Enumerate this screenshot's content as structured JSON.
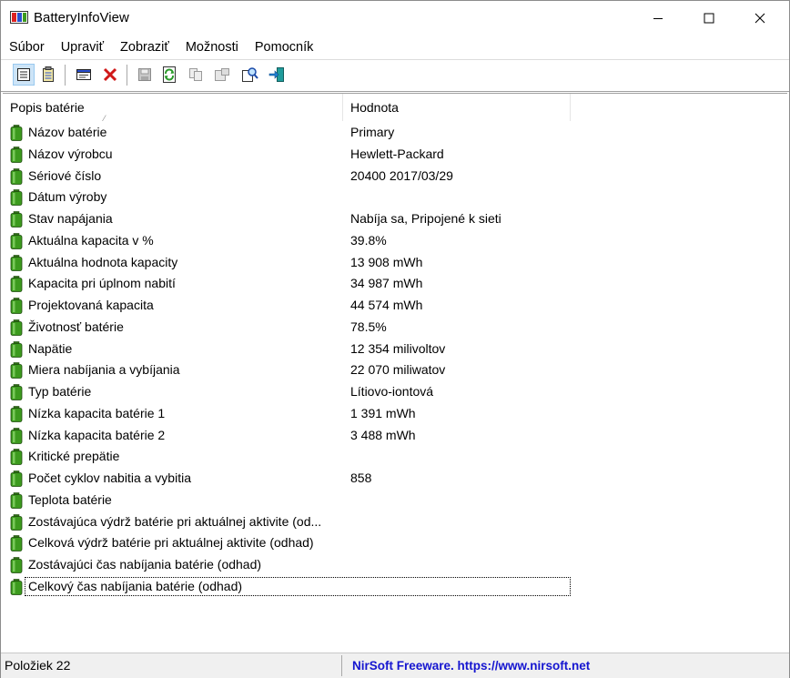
{
  "window": {
    "title": "BatteryInfoView"
  },
  "menu": [
    "Súbor",
    "Upraviť",
    "Zobraziť",
    "Možnosti",
    "Pomocník"
  ],
  "columns": {
    "name": "Popis batérie",
    "value": "Hodnota"
  },
  "rows": [
    {
      "name": "Názov batérie",
      "value": "Primary"
    },
    {
      "name": "Názov výrobcu",
      "value": "Hewlett-Packard"
    },
    {
      "name": "Sériové číslo",
      "value": "20400 2017/03/29"
    },
    {
      "name": "Dátum výroby",
      "value": ""
    },
    {
      "name": "Stav napájania",
      "value": "Nabíja sa, Pripojené k sieti"
    },
    {
      "name": "Aktuálna kapacita v %",
      "value": "39.8%"
    },
    {
      "name": "Aktuálna hodnota kapacity",
      "value": "13 908 mWh"
    },
    {
      "name": "Kapacita pri úplnom nabití",
      "value": "34 987 mWh"
    },
    {
      "name": "Projektovaná kapacita",
      "value": "44 574 mWh"
    },
    {
      "name": "Životnosť batérie",
      "value": "78.5%"
    },
    {
      "name": "Napätie",
      "value": "12 354 milivoltov"
    },
    {
      "name": "Miera nabíjania a vybíjania",
      "value": "22 070 miliwatov"
    },
    {
      "name": "Typ batérie",
      "value": "Lítiovo-iontová"
    },
    {
      "name": "Nízka kapacita batérie 1",
      "value": "1 391 mWh"
    },
    {
      "name": "Nízka kapacita batérie 2",
      "value": "3 488 mWh"
    },
    {
      "name": "Kritické prepätie",
      "value": ""
    },
    {
      "name": "Počet cyklov nabitia a vybitia",
      "value": "858"
    },
    {
      "name": "Teplota batérie",
      "value": ""
    },
    {
      "name": "Zostávajúca výdrž batérie pri aktuálnej aktivite (od...",
      "value": ""
    },
    {
      "name": "Celková výdrž batérie pri aktuálnej aktivite (odhad)",
      "value": ""
    },
    {
      "name": "Zostávajúci čas nabíjania batérie (odhad)",
      "value": ""
    },
    {
      "name": "Celkový čas nabíjania batérie (odhad)",
      "value": ""
    }
  ],
  "status": {
    "items": "Položiek 22",
    "link": "NirSoft Freeware. https://www.nirsoft.net"
  },
  "colors": {
    "battery": "#3c9a1e",
    "link": "#1515d0",
    "selected_button": "#cde4f7"
  }
}
